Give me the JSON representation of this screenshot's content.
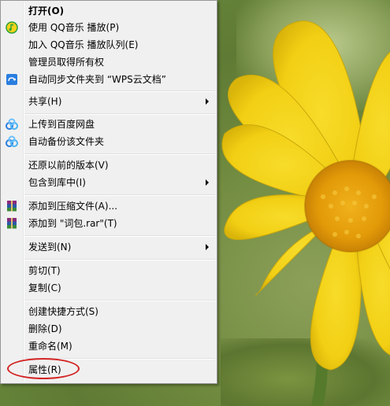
{
  "menu": {
    "items": [
      {
        "label": "打开(O)",
        "bold": true
      },
      {
        "label": "使用 QQ音乐 播放(P)",
        "icon": "qq-music-icon"
      },
      {
        "label": "加入 QQ音乐 播放队列(E)"
      },
      {
        "label": "管理员取得所有权"
      },
      {
        "label": "自动同步文件夹到 “WPS云文档”",
        "icon": "wps-cloud-icon"
      },
      {
        "label": "共享(H)",
        "submenu": true
      },
      {
        "label": "上传到百度网盘",
        "icon": "baidu-netdisk-icon"
      },
      {
        "label": "自动备份该文件夹",
        "icon": "baidu-netdisk-icon"
      },
      {
        "label": "还原以前的版本(V)"
      },
      {
        "label": "包含到库中(I)",
        "submenu": true
      },
      {
        "label": "添加到压缩文件(A)...",
        "icon": "winrar-icon"
      },
      {
        "label": "添加到 \"词包.rar\"(T)",
        "icon": "winrar-icon"
      },
      {
        "label": "发送到(N)",
        "submenu": true
      },
      {
        "label": "剪切(T)"
      },
      {
        "label": "复制(C)"
      },
      {
        "label": "创建快捷方式(S)"
      },
      {
        "label": "删除(D)"
      },
      {
        "label": "重命名(M)"
      },
      {
        "label": "属性(R)",
        "highlighted": true
      }
    ]
  },
  "colors": {
    "menu_bg": "#f0f0f0",
    "menu_border": "#979797",
    "highlight_circle": "#d42424",
    "flower_petal": "#f4d21a",
    "flower_center": "#e8a90c"
  }
}
